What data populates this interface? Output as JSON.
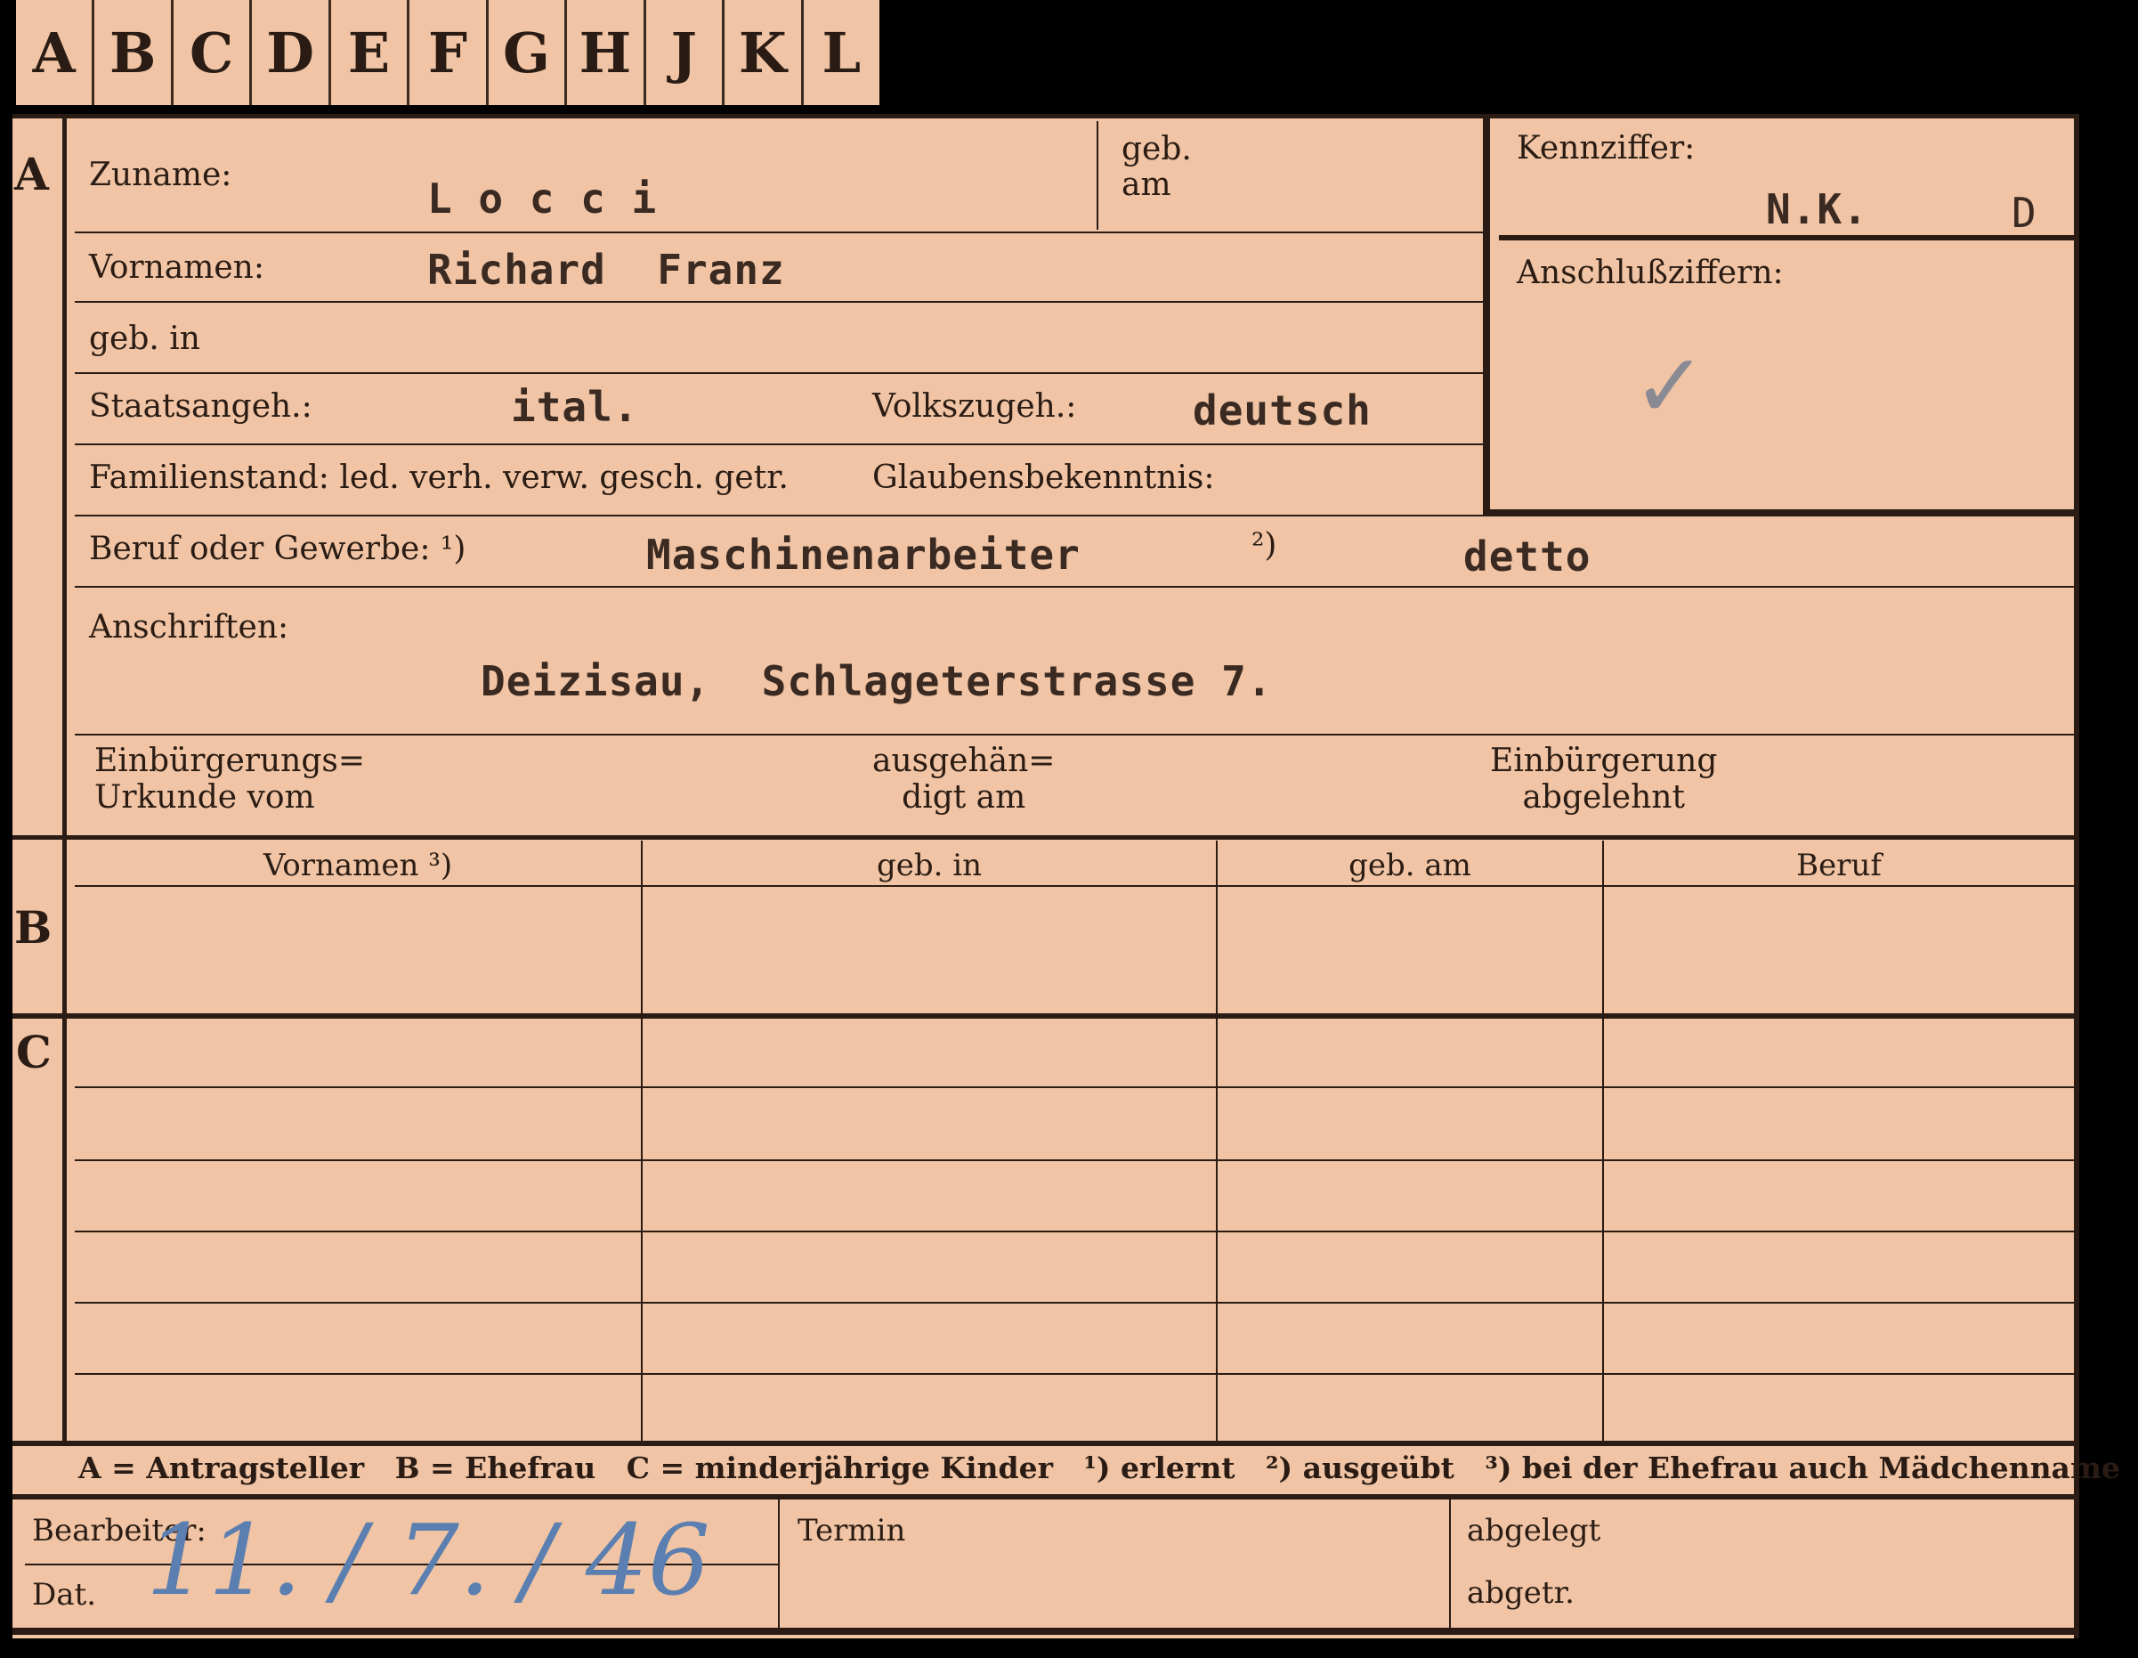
{
  "tabs": [
    "A",
    "B",
    "C",
    "D",
    "E",
    "F",
    "G",
    "H",
    "J",
    "K",
    "L"
  ],
  "sections": {
    "a": "A",
    "b": "B",
    "c": "C"
  },
  "labels": {
    "zuname": "Zuname:",
    "geb_am": "geb.\nam",
    "kennziffer": "Kennziffer:",
    "vornamen": "Vornamen:",
    "anschlussziffern": "Anschlußziffern:",
    "geb_in": "geb. in",
    "staatsangeh": "Staatsangeh.:",
    "volkszugeh": "Volkszugeh.:",
    "familienstand": "Familienstand: led. verh. verw. gesch. getr.",
    "glaubensbekenntnis": "Glaubensbekenntnis:",
    "beruf": "Beruf oder Gewerbe: ¹)",
    "beruf_mark2": "²)",
    "anschriften": "Anschriften:",
    "einbuergerung_urkunde": "Einbürgerungs=\nUrkunde vom",
    "ausgehaendigt": "ausgehän=\ndigt am",
    "einbuergerung_abgelehnt": "Einbürgerung\nabgelehnt",
    "bearbeiter": "Bearbeiter:",
    "dat": "Dat.",
    "termin": "Termin",
    "abgelegt": "abgelegt",
    "abgetr": "abgetr."
  },
  "values": {
    "zuname": "L o c c i",
    "kennziffer": "N.K.",
    "kennziffer_suffix": "D",
    "vornamen": "Richard  Franz",
    "staatsangeh": "ital.",
    "volkszugeh": "deutsch",
    "beruf_erlernt": "Maschinenarbeiter",
    "beruf_ausgeuebt": "detto",
    "anschrift": "Deizisau,  Schlageterstrasse 7.",
    "checkmark": "✓",
    "signature": "11. / 7. / 46"
  },
  "table": {
    "headers": [
      "Vornamen ³)",
      "geb. in",
      "geb. am",
      "Beruf"
    ]
  },
  "legend": "A = Antragsteller   B = Ehefrau   C = minderjährige Kinder   ¹) erlernt   ²) ausgeübt   ³) bei der Ehefrau auch Mädchenname"
}
